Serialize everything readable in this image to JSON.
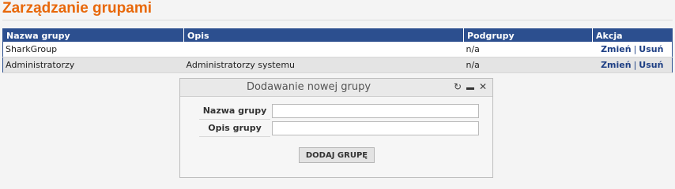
{
  "page": {
    "title": "Zarządzanie grupami"
  },
  "table": {
    "headers": [
      "Nazwa grupy",
      "Opis",
      "Podgrupy",
      "Akcja"
    ],
    "rows": [
      {
        "name": "SharkGroup",
        "description": "",
        "subgroups": "n/a",
        "edit": "Zmień",
        "delete": "Usuń"
      },
      {
        "name": "Administratorzy",
        "description": "Administratorzy systemu",
        "subgroups": "n/a",
        "edit": "Zmień",
        "delete": "Usuń"
      }
    ],
    "separator": "|"
  },
  "dialog": {
    "title": "Dodawanie nowej grupy",
    "icons": [
      "refresh-icon",
      "minimize-icon",
      "close-icon"
    ],
    "fields": [
      {
        "label": "Nazwa grupy",
        "value": ""
      },
      {
        "label": "Opis grupy",
        "value": ""
      }
    ],
    "submit_label": "DODAJ GRUPĘ"
  },
  "colors": {
    "accent": "#e8680a",
    "header_bg": "#2c4f8f",
    "link": "#1e3f84"
  }
}
